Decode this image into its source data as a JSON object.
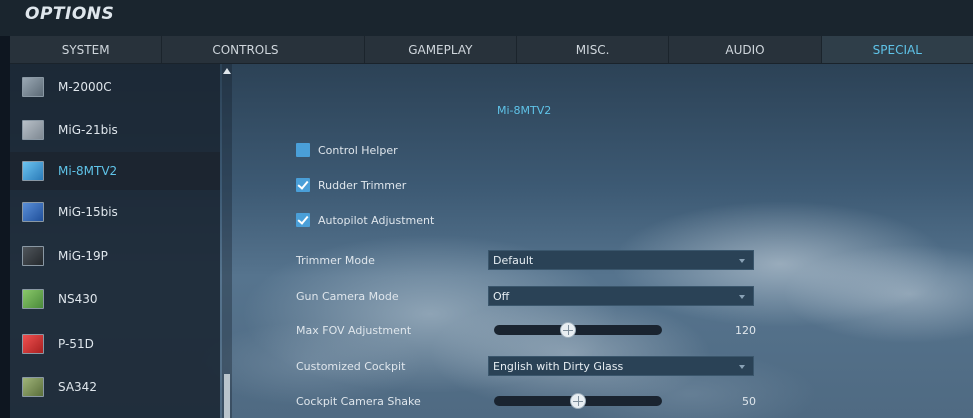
{
  "window": {
    "title": "OPTIONS"
  },
  "tabs": [
    {
      "label": "SYSTEM",
      "active": false
    },
    {
      "label": "CONTROLS",
      "active": false
    },
    {
      "label": "GAMEPLAY",
      "active": false
    },
    {
      "label": "MISC.",
      "active": false
    },
    {
      "label": "AUDIO",
      "active": false
    },
    {
      "label": "SPECIAL",
      "active": true
    }
  ],
  "sidebar": {
    "items": [
      {
        "label": "M-2000C",
        "icon": "m2000c-aircraft-icon",
        "color": "#8a9aa8"
      },
      {
        "label": "MiG-21bis",
        "icon": "mig21bis-aircraft-icon",
        "color": "#9aa4ae"
      },
      {
        "label": "Mi-8MTV2",
        "icon": "mi8mtv2-helicopter-icon",
        "color": "#4aa8e0",
        "selected": true
      },
      {
        "label": "MiG-15bis",
        "icon": "mig15bis-aircraft-icon",
        "color": "#3a70c0"
      },
      {
        "label": "MiG-19P",
        "icon": "mig19p-aircraft-icon",
        "color": "#3a3f44"
      },
      {
        "label": "NS430",
        "icon": "ns430-map-icon",
        "color": "#6fae5a"
      },
      {
        "label": "P-51D",
        "icon": "p51d-aircraft-icon",
        "color": "#d43a3a"
      },
      {
        "label": "SA342",
        "icon": "sa342-helicopter-icon",
        "color": "#7a8e5a"
      }
    ]
  },
  "main": {
    "module_title": "Mi-8MTV2",
    "checkboxes": [
      {
        "label": "Control Helper",
        "checked": false
      },
      {
        "label": "Rudder Trimmer",
        "checked": true
      },
      {
        "label": "Autopilot Adjustment",
        "checked": true
      }
    ],
    "trimmer_mode": {
      "label": "Trimmer Mode",
      "value": "Default"
    },
    "gun_camera_mode": {
      "label": "Gun Camera Mode",
      "value": "Off"
    },
    "max_fov": {
      "label": "Max FOV Adjustment",
      "value": "120",
      "fraction": 0.44
    },
    "customized_cockpit": {
      "label": "Customized Cockpit",
      "value": "English with Dirty Glass"
    },
    "cockpit_shake": {
      "label": "Cockpit Camera Shake",
      "value": "50",
      "fraction": 0.5
    }
  },
  "colors": {
    "accent": "#5fc3e8",
    "checkbox": "#4a9fd8"
  }
}
